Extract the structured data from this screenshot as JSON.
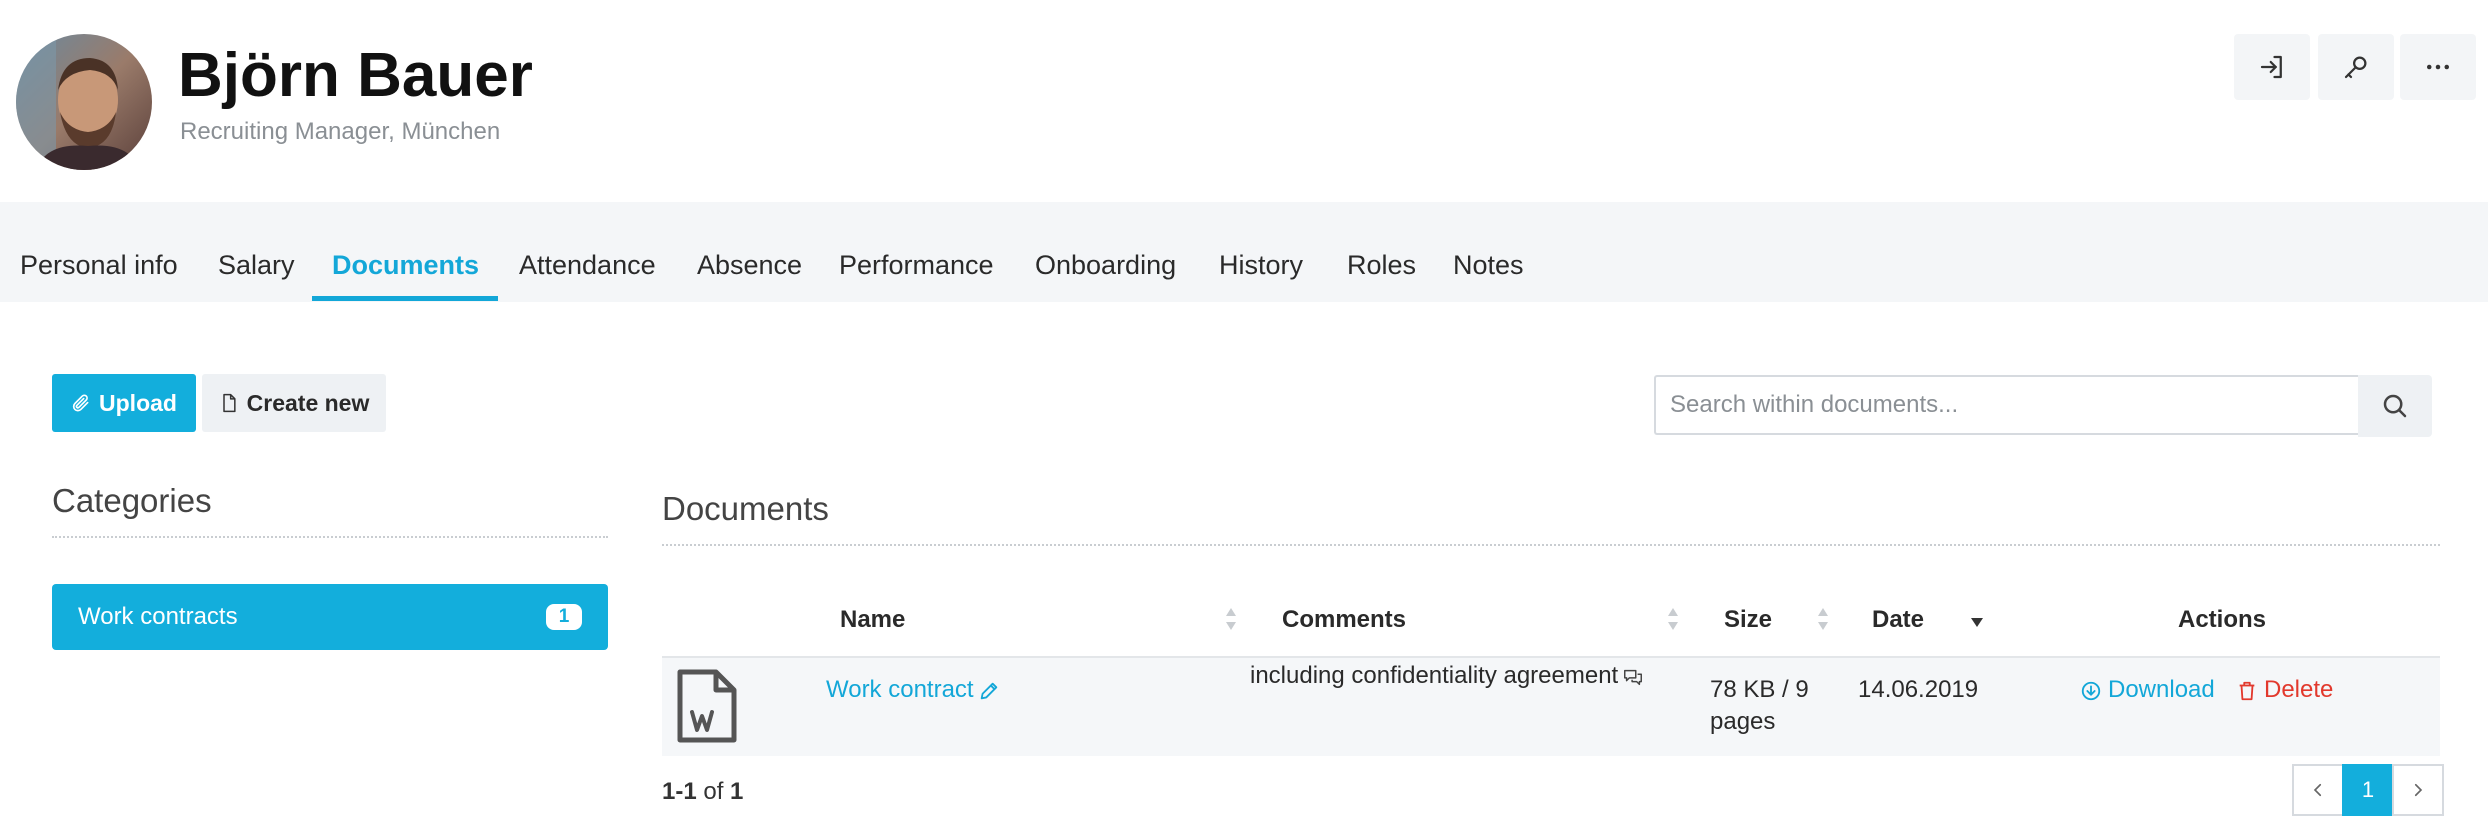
{
  "profile": {
    "name": "Björn Bauer",
    "subtitle": "Recruiting Manager, München",
    "avatar_icon": "user-photo"
  },
  "header_actions": [
    {
      "icon": "sign-in-icon"
    },
    {
      "icon": "key-icon"
    },
    {
      "icon": "more-icon"
    }
  ],
  "tabs": [
    {
      "label": "Personal info"
    },
    {
      "label": "Salary"
    },
    {
      "label": "Documents",
      "active": true
    },
    {
      "label": "Attendance"
    },
    {
      "label": "Absence"
    },
    {
      "label": "Performance"
    },
    {
      "label": "Onboarding"
    },
    {
      "label": "History"
    },
    {
      "label": "Roles"
    },
    {
      "label": "Notes"
    }
  ],
  "toolbar": {
    "upload_label": "Upload",
    "create_label": "Create new",
    "search_placeholder": "Search within documents..."
  },
  "categories": {
    "title": "Categories",
    "items": [
      {
        "label": "Work contracts",
        "count": "1"
      }
    ]
  },
  "documents": {
    "title": "Documents",
    "columns": {
      "name": "Name",
      "comments": "Comments",
      "size": "Size",
      "date": "Date",
      "actions": "Actions"
    },
    "rows": [
      {
        "name": "Work contract",
        "comment": "including confidentiality agreement",
        "size_line1": "78 KB / 9",
        "size_line2": "pages",
        "date": "14.06.2019",
        "download_label": "Download",
        "delete_label": "Delete"
      }
    ],
    "pagination": {
      "range": "1-1",
      "of_label": "of",
      "total": "1",
      "current_page": "1"
    }
  },
  "colors": {
    "accent": "#13aedc",
    "danger": "#e2392d"
  }
}
